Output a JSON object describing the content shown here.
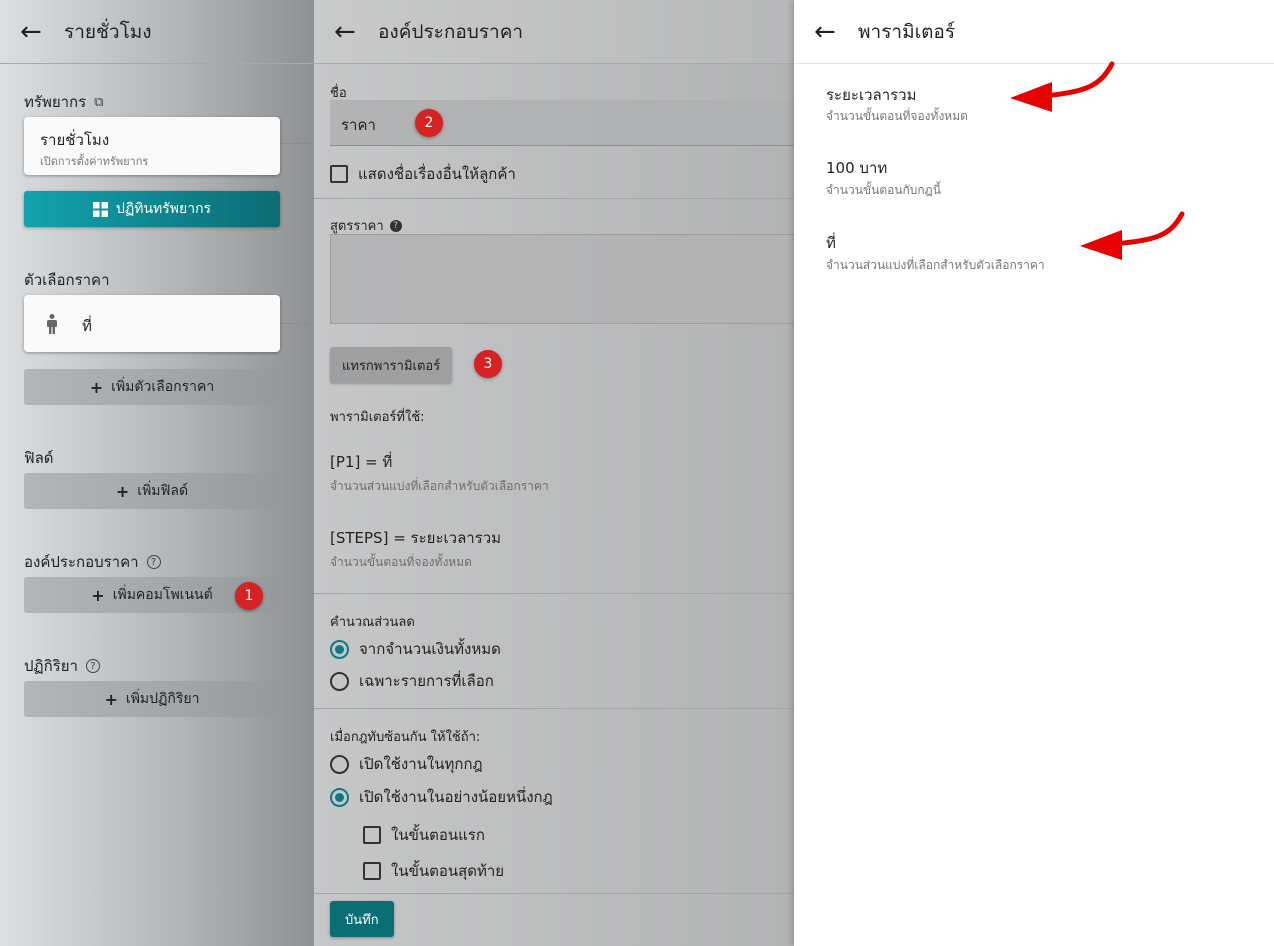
{
  "left_panel": {
    "title": "รายชั่วโมง",
    "resources_label": "ทรัพยากร",
    "resource_card": {
      "title": "รายชั่วโมง",
      "subtitle": "เปิดการตั้งค่าทรัพยากร"
    },
    "calendar_button": "ปฏิทินทรัพยากร",
    "price_options_label": "ตัวเลือกราคา",
    "price_option_item": "ที่",
    "add_price_option": "เพิ่มตัวเลือกราคา",
    "fields_label": "ฟิลด์",
    "add_field": "เพิ่มฟิลด์",
    "components_label": "องค์ประกอบราคา",
    "add_component": "เพิ่มคอมโพเนนต์",
    "actions_label": "ปฏิกิริยา",
    "add_action": "เพิ่มปฏิกิริยา"
  },
  "middle_panel": {
    "title": "องค์ประกอบราคา",
    "name_label": "ชื่อ",
    "name_value": "ราคา",
    "show_other_title": "แสดงชื่อเรื่องอื่นให้ลูกค้า",
    "formula_label": "สูตรราคา",
    "insert_param_button": "แทรกพารามิเตอร์",
    "params_used_label": "พารามิเตอร์ที่ใช้:",
    "params_used": [
      {
        "code": "[P1]",
        "name": "= ที่",
        "desc": "จำนวนส่วนแบ่งที่เลือกสำหรับตัวเลือกราคา"
      },
      {
        "code": "[STEPS]",
        "name": "= ระยะเวลารวม",
        "desc": "จำนวนขั้นตอนที่จองทั้งหมด"
      }
    ],
    "discount_label": "คำนวณส่วนลด",
    "discount_options": [
      "จากจำนวนเงินทั้งหมด",
      "เฉพาะรายการที่เลือก"
    ],
    "overlap_label": "เมื่อกฎทับซ้อนกัน ให้ใช้ถ้า:",
    "overlap_options": [
      "เปิดใช้งานในทุกกฎ",
      "เปิดใช้งานในอย่างน้อยหนึ่งกฎ"
    ],
    "step_checks": [
      "ในขั้นตอนแรก",
      "ในขั้นตอนสุดท้าย"
    ],
    "save_button": "บันทึก"
  },
  "right_panel": {
    "title": "พารามิเตอร์",
    "options": [
      {
        "title": "ระยะเวลารวม",
        "desc": "จำนวนขั้นตอนที่จองทั้งหมด"
      },
      {
        "title": "100 บาท",
        "desc": "จำนวนขั้นตอนกับกฎนี้"
      },
      {
        "title": "ที่",
        "desc": "จำนวนส่วนแบ่งที่เลือกสำหรับตัวเลือกราคา"
      }
    ]
  },
  "badges": {
    "one": "1",
    "two": "2",
    "three": "3"
  },
  "colors": {
    "accent": "#0c7a82",
    "badge": "#d62222",
    "arrow": "#e60000"
  },
  "icons": {
    "back": "arrow-left-icon",
    "copy": "copy-icon",
    "grid": "grid-icon",
    "person": "person-icon",
    "help": "help-icon",
    "plus": "plus-icon"
  }
}
